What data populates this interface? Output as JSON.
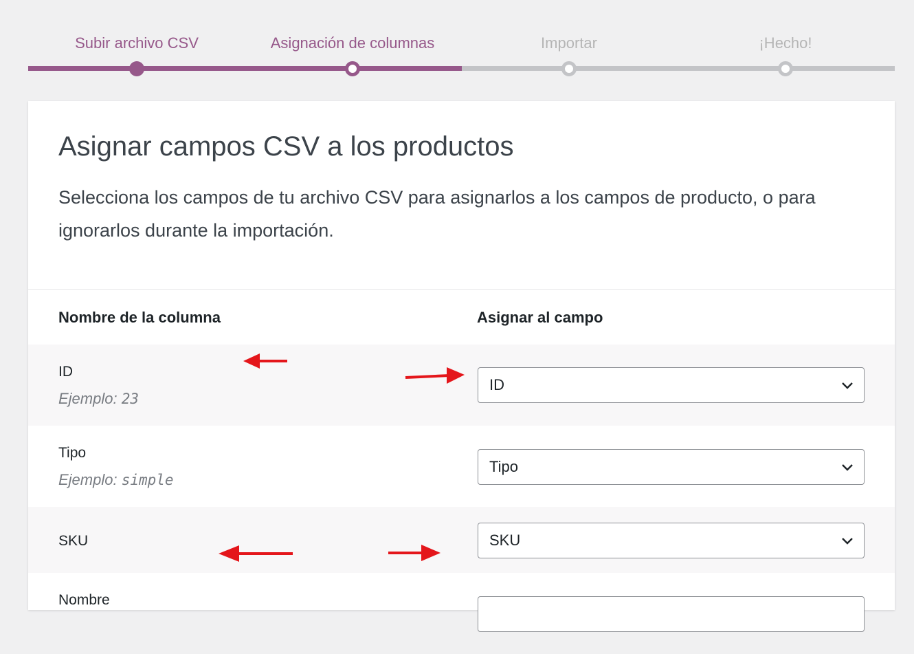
{
  "steps": [
    {
      "label": "Subir archivo CSV",
      "state": "done"
    },
    {
      "label": "Asignación de columnas",
      "state": "active"
    },
    {
      "label": "Importar",
      "state": "todo"
    },
    {
      "label": "¡Hecho!",
      "state": "todo"
    }
  ],
  "card": {
    "title": "Asignar campos CSV a los productos",
    "description": "Selecciona los campos de tu archivo CSV para asignarlos a los campos de producto, o para ignorarlos durante la importación."
  },
  "table": {
    "col_name_header": "Nombre de la columna",
    "col_map_header": "Asignar al campo",
    "example_prefix": "Ejemplo:",
    "rows": [
      {
        "name": "ID",
        "example": "23",
        "selected": "ID"
      },
      {
        "name": "Tipo",
        "example": "simple",
        "selected": "Tipo"
      },
      {
        "name": "SKU",
        "example": "",
        "selected": "SKU"
      },
      {
        "name": "Nombre",
        "example": "",
        "selected": ""
      }
    ]
  },
  "colors": {
    "accent": "#96588a",
    "annotation_arrow": "#e4161b",
    "inactive": "#c3c4c7"
  }
}
